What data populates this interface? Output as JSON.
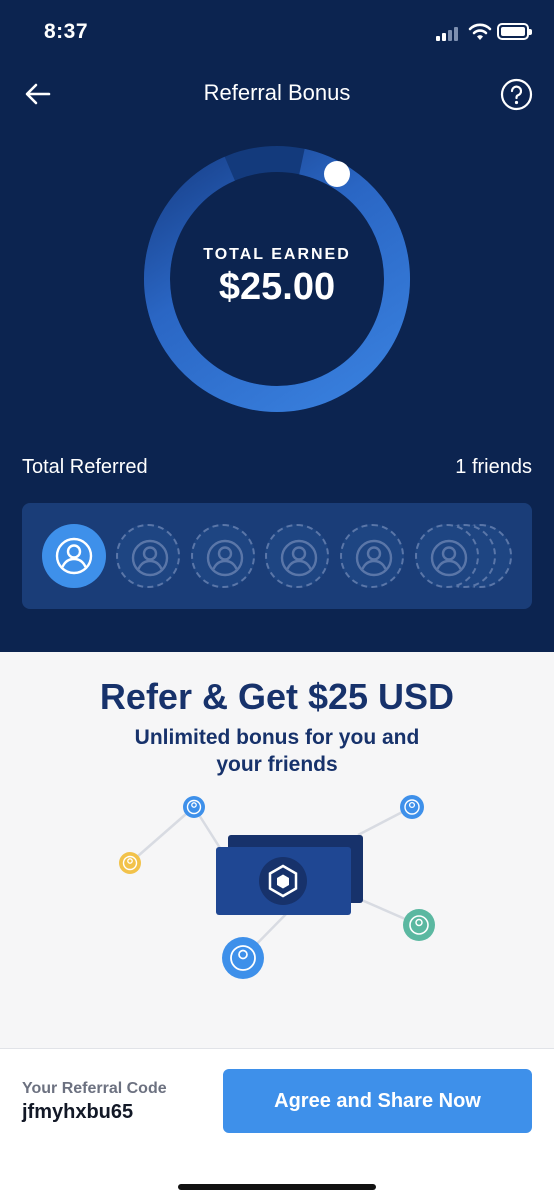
{
  "status_bar": {
    "time": "8:37",
    "icons": [
      "signal-icon",
      "wifi-icon",
      "battery-icon"
    ]
  },
  "nav": {
    "back_icon": "arrow-left-icon",
    "title": "Referral Bonus",
    "help_icon": "question-circle-icon"
  },
  "earnings": {
    "label": "TOTAL EARNED",
    "amount": "$25.00"
  },
  "referrals": {
    "label": "Total Referred",
    "count_text": "1 friends",
    "slots": [
      "filled",
      "empty",
      "empty",
      "empty",
      "empty",
      "empty-stack"
    ]
  },
  "promo": {
    "title": "Refer & Get $25 USD",
    "subtitle": "Unlimited bonus for you and your friends",
    "illustration_icons": [
      "card-icon",
      "crypto-logo-icon",
      "user-icon"
    ]
  },
  "footer": {
    "code_label": "Your Referral Code",
    "code_value": "jfmyhxbu65",
    "share_button": "Agree and Share Now"
  },
  "colors": {
    "header_bg": "#0c2450",
    "accent": "#3e90ea",
    "title_navy": "#17326b",
    "avatar_yellow": "#f2c24a",
    "avatar_teal": "#5bb8a1"
  }
}
